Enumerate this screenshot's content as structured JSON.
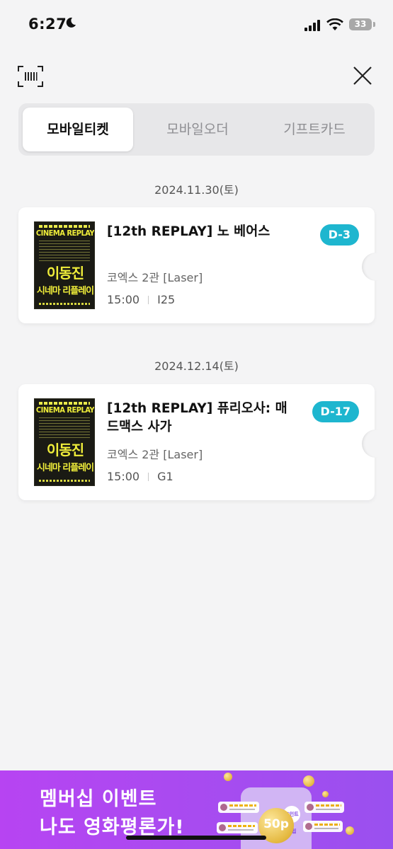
{
  "status_bar": {
    "time": "6:27",
    "battery": "33"
  },
  "tabs": [
    {
      "label": "모바일티켓",
      "active": true
    },
    {
      "label": "모바일오더",
      "active": false
    },
    {
      "label": "기프트카드",
      "active": false
    }
  ],
  "tickets": [
    {
      "date": "2024.11.30(토)",
      "title": "[12th REPLAY] 노 베어스",
      "venue": "코엑스 2관 [Laser]",
      "time": "15:00",
      "seat": "I25",
      "dday": "D-3",
      "poster": {
        "line1": "CINEMA REPLAY",
        "line2": "이동진",
        "line3": "시네마 리플레이"
      }
    },
    {
      "date": "2024.12.14(토)",
      "title": "[12th REPLAY] 퓨리오사: 매드맥스 사가",
      "venue": "코엑스 2관 [Laser]",
      "time": "15:00",
      "seat": "G1",
      "dday": "D-17",
      "poster": {
        "line1": "CINEMA REPLAY",
        "line2": "이동진",
        "line3": "시네마 리플레이"
      }
    }
  ],
  "banner": {
    "line1": "멤버십 이벤트",
    "line2": "나도 영화평론가!",
    "coin_label": "50p",
    "badge": "포인트 적립"
  },
  "colors": {
    "accent": "#1eb6cf",
    "banner": "#a84bf0",
    "poster_yellow": "#f0ee3a"
  },
  "icons": {
    "scan": "barcode-scan-icon",
    "close": "close-icon"
  }
}
